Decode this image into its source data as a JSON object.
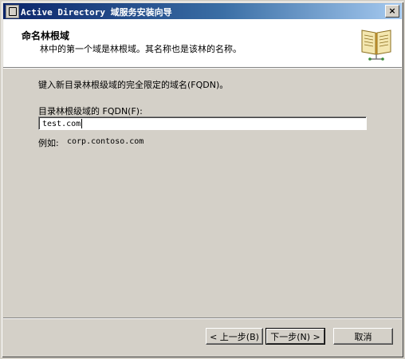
{
  "window": {
    "title": "Active Directory 域服务安装向导",
    "close_label": "×"
  },
  "header": {
    "title": "命名林根域",
    "subtitle": "林中的第一个域是林根域。其名称也是该林的名称。"
  },
  "main": {
    "instruction": "键入新目录林根级域的完全限定的域名(FQDN)。",
    "fqdn_label": "目录林根级域的 FQDN(F):",
    "fqdn_value": "test.com",
    "example_label": "例如:",
    "example_value": "corp.contoso.com"
  },
  "buttons": {
    "back": "< 上一步(B)",
    "next": "下一步(N) >",
    "cancel": "取消"
  },
  "colors": {
    "titlebar_start": "#0a246a",
    "titlebar_end": "#a6caf0",
    "dialog_bg": "#d4d0c8"
  },
  "icons": {
    "window": "wizard-window-icon",
    "header": "book-icon"
  }
}
